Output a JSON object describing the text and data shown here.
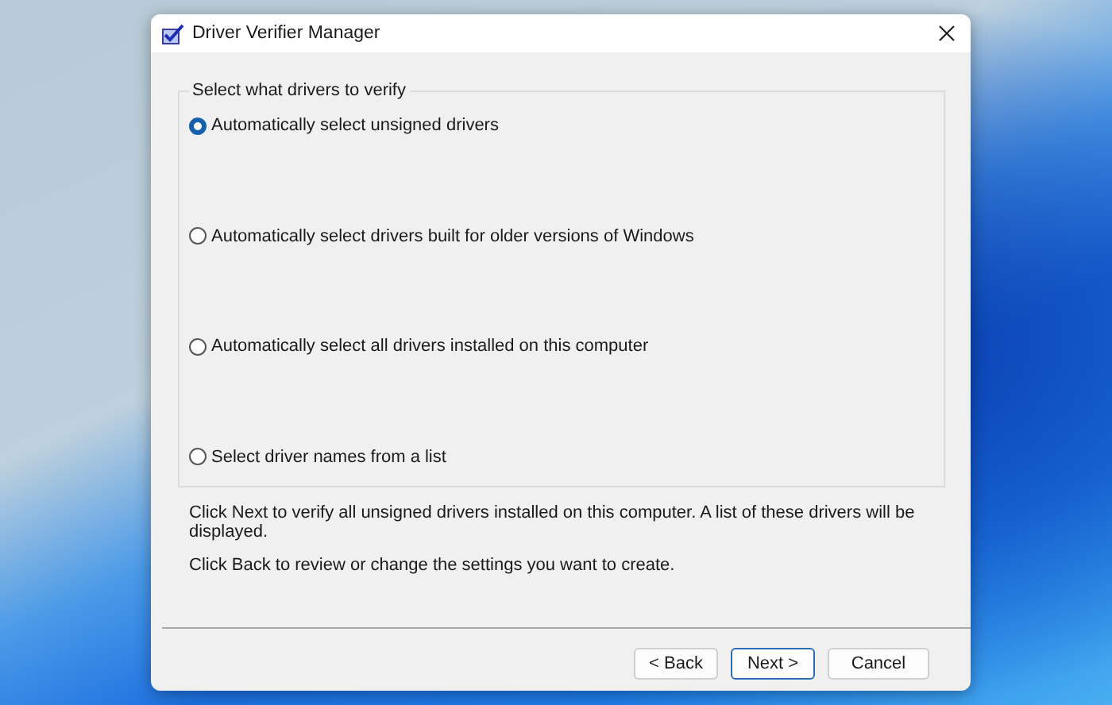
{
  "window": {
    "title": "Driver Verifier Manager"
  },
  "group": {
    "label": "Select what drivers to verify",
    "options": [
      {
        "label": "Automatically select unsigned drivers",
        "selected": true
      },
      {
        "label": "Automatically select drivers built for older versions of Windows",
        "selected": false
      },
      {
        "label": "Automatically select all drivers installed on this computer",
        "selected": false
      },
      {
        "label": "Select driver names from a list",
        "selected": false
      }
    ]
  },
  "messages": [
    "Click Next to verify all unsigned drivers installed on this computer. A list of these drivers will be displayed.",
    "Click Back to review or change the settings you want to create."
  ],
  "buttons": [
    {
      "label": "< Back",
      "default": false
    },
    {
      "label": "Next >",
      "default": true
    },
    {
      "label": "Cancel",
      "default": false
    }
  ]
}
